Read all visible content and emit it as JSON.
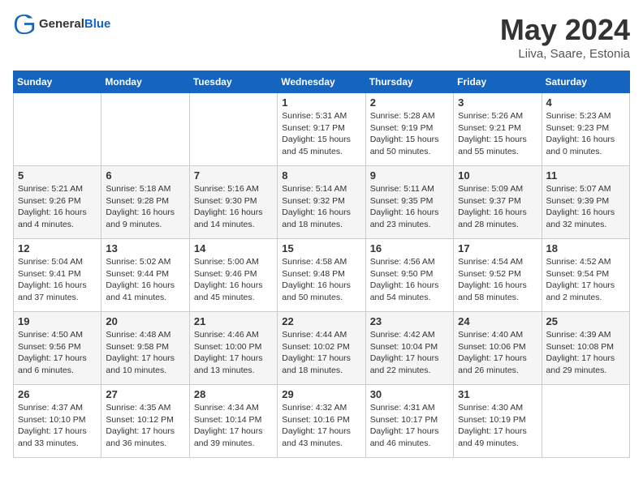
{
  "header": {
    "logo_general": "General",
    "logo_blue": "Blue",
    "month_title": "May 2024",
    "location": "Liiva, Saare, Estonia"
  },
  "weekdays": [
    "Sunday",
    "Monday",
    "Tuesday",
    "Wednesday",
    "Thursday",
    "Friday",
    "Saturday"
  ],
  "weeks": [
    [
      {
        "day": "",
        "info": ""
      },
      {
        "day": "",
        "info": ""
      },
      {
        "day": "",
        "info": ""
      },
      {
        "day": "1",
        "info": "Sunrise: 5:31 AM\nSunset: 9:17 PM\nDaylight: 15 hours\nand 45 minutes."
      },
      {
        "day": "2",
        "info": "Sunrise: 5:28 AM\nSunset: 9:19 PM\nDaylight: 15 hours\nand 50 minutes."
      },
      {
        "day": "3",
        "info": "Sunrise: 5:26 AM\nSunset: 9:21 PM\nDaylight: 15 hours\nand 55 minutes."
      },
      {
        "day": "4",
        "info": "Sunrise: 5:23 AM\nSunset: 9:23 PM\nDaylight: 16 hours\nand 0 minutes."
      }
    ],
    [
      {
        "day": "5",
        "info": "Sunrise: 5:21 AM\nSunset: 9:26 PM\nDaylight: 16 hours\nand 4 minutes."
      },
      {
        "day": "6",
        "info": "Sunrise: 5:18 AM\nSunset: 9:28 PM\nDaylight: 16 hours\nand 9 minutes."
      },
      {
        "day": "7",
        "info": "Sunrise: 5:16 AM\nSunset: 9:30 PM\nDaylight: 16 hours\nand 14 minutes."
      },
      {
        "day": "8",
        "info": "Sunrise: 5:14 AM\nSunset: 9:32 PM\nDaylight: 16 hours\nand 18 minutes."
      },
      {
        "day": "9",
        "info": "Sunrise: 5:11 AM\nSunset: 9:35 PM\nDaylight: 16 hours\nand 23 minutes."
      },
      {
        "day": "10",
        "info": "Sunrise: 5:09 AM\nSunset: 9:37 PM\nDaylight: 16 hours\nand 28 minutes."
      },
      {
        "day": "11",
        "info": "Sunrise: 5:07 AM\nSunset: 9:39 PM\nDaylight: 16 hours\nand 32 minutes."
      }
    ],
    [
      {
        "day": "12",
        "info": "Sunrise: 5:04 AM\nSunset: 9:41 PM\nDaylight: 16 hours\nand 37 minutes."
      },
      {
        "day": "13",
        "info": "Sunrise: 5:02 AM\nSunset: 9:44 PM\nDaylight: 16 hours\nand 41 minutes."
      },
      {
        "day": "14",
        "info": "Sunrise: 5:00 AM\nSunset: 9:46 PM\nDaylight: 16 hours\nand 45 minutes."
      },
      {
        "day": "15",
        "info": "Sunrise: 4:58 AM\nSunset: 9:48 PM\nDaylight: 16 hours\nand 50 minutes."
      },
      {
        "day": "16",
        "info": "Sunrise: 4:56 AM\nSunset: 9:50 PM\nDaylight: 16 hours\nand 54 minutes."
      },
      {
        "day": "17",
        "info": "Sunrise: 4:54 AM\nSunset: 9:52 PM\nDaylight: 16 hours\nand 58 minutes."
      },
      {
        "day": "18",
        "info": "Sunrise: 4:52 AM\nSunset: 9:54 PM\nDaylight: 17 hours\nand 2 minutes."
      }
    ],
    [
      {
        "day": "19",
        "info": "Sunrise: 4:50 AM\nSunset: 9:56 PM\nDaylight: 17 hours\nand 6 minutes."
      },
      {
        "day": "20",
        "info": "Sunrise: 4:48 AM\nSunset: 9:58 PM\nDaylight: 17 hours\nand 10 minutes."
      },
      {
        "day": "21",
        "info": "Sunrise: 4:46 AM\nSunset: 10:00 PM\nDaylight: 17 hours\nand 13 minutes."
      },
      {
        "day": "22",
        "info": "Sunrise: 4:44 AM\nSunset: 10:02 PM\nDaylight: 17 hours\nand 18 minutes."
      },
      {
        "day": "23",
        "info": "Sunrise: 4:42 AM\nSunset: 10:04 PM\nDaylight: 17 hours\nand 22 minutes."
      },
      {
        "day": "24",
        "info": "Sunrise: 4:40 AM\nSunset: 10:06 PM\nDaylight: 17 hours\nand 26 minutes."
      },
      {
        "day": "25",
        "info": "Sunrise: 4:39 AM\nSunset: 10:08 PM\nDaylight: 17 hours\nand 29 minutes."
      }
    ],
    [
      {
        "day": "26",
        "info": "Sunrise: 4:37 AM\nSunset: 10:10 PM\nDaylight: 17 hours\nand 33 minutes."
      },
      {
        "day": "27",
        "info": "Sunrise: 4:35 AM\nSunset: 10:12 PM\nDaylight: 17 hours\nand 36 minutes."
      },
      {
        "day": "28",
        "info": "Sunrise: 4:34 AM\nSunset: 10:14 PM\nDaylight: 17 hours\nand 39 minutes."
      },
      {
        "day": "29",
        "info": "Sunrise: 4:32 AM\nSunset: 10:16 PM\nDaylight: 17 hours\nand 43 minutes."
      },
      {
        "day": "30",
        "info": "Sunrise: 4:31 AM\nSunset: 10:17 PM\nDaylight: 17 hours\nand 46 minutes."
      },
      {
        "day": "31",
        "info": "Sunrise: 4:30 AM\nSunset: 10:19 PM\nDaylight: 17 hours\nand 49 minutes."
      },
      {
        "day": "",
        "info": ""
      }
    ]
  ]
}
